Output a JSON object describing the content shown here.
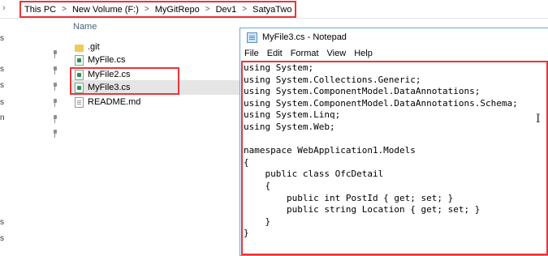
{
  "address_bar": {
    "crumbs": [
      "This PC",
      "New Volume (F:)",
      "MyGitRepo",
      "Dev1",
      "SatyaTwo"
    ],
    "separator": ">"
  },
  "explorer": {
    "column_header": "Name",
    "files": [
      {
        "name": ".git",
        "icon": "folder-icon"
      },
      {
        "name": "MyFile.cs",
        "icon": "cs-file-icon"
      },
      {
        "name": "MyFile2.cs",
        "icon": "cs-file-icon"
      },
      {
        "name": "MyFile3.cs",
        "icon": "cs-file-icon"
      },
      {
        "name": "README.md",
        "icon": "md-file-icon"
      }
    ],
    "selected": "MyFile3.cs",
    "left_nav_fragments": [
      "s",
      "s",
      "s",
      "s",
      "n",
      "s",
      "s"
    ]
  },
  "notepad": {
    "title": "MyFile3.cs - Notepad",
    "menu": [
      "File",
      "Edit",
      "Format",
      "View",
      "Help"
    ],
    "code_lines": [
      "using System;",
      "using System.Collections.Generic;",
      "using System.ComponentModel.DataAnnotations;",
      "using System.ComponentModel.DataAnnotations.Schema;",
      "using System.Linq;",
      "using System.Web;",
      "",
      "namespace WebApplication1.Models",
      "{",
      "    public class OfcDetail",
      "    {",
      "        public int PostId { get; set; }",
      "        public string Location { get; set; }",
      "    }",
      "}"
    ]
  },
  "colors": {
    "highlight_box": "#e5363b",
    "selection": "#e5e5e5",
    "window_border": "#6fa6d6"
  }
}
